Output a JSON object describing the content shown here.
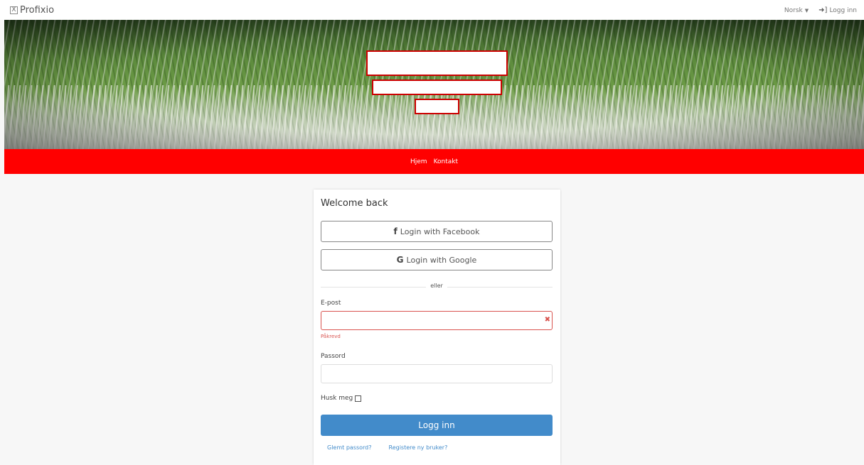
{
  "topbar": {
    "logo_text": "Profixio",
    "logo_mark": "X",
    "language": "Norsk",
    "login_link": "Logg inn"
  },
  "nav": {
    "items": [
      "Hjem",
      "Kontakt"
    ]
  },
  "card": {
    "title": "Welcome back",
    "facebook_label": "Login with Facebook",
    "google_label": "Login with Google",
    "divider": "eller",
    "email_label": "E-post",
    "email_value": "",
    "email_error": "Påkrevd",
    "password_label": "Passord",
    "password_value": "",
    "remember_label": "Husk meg",
    "submit_label": "Logg inn",
    "forgot_link": "Glemt passord?",
    "register_link": "Registere ny bruker?"
  },
  "colors": {
    "nav_bg": "#ff0000",
    "primary": "#428bca",
    "error": "#d9534f"
  }
}
